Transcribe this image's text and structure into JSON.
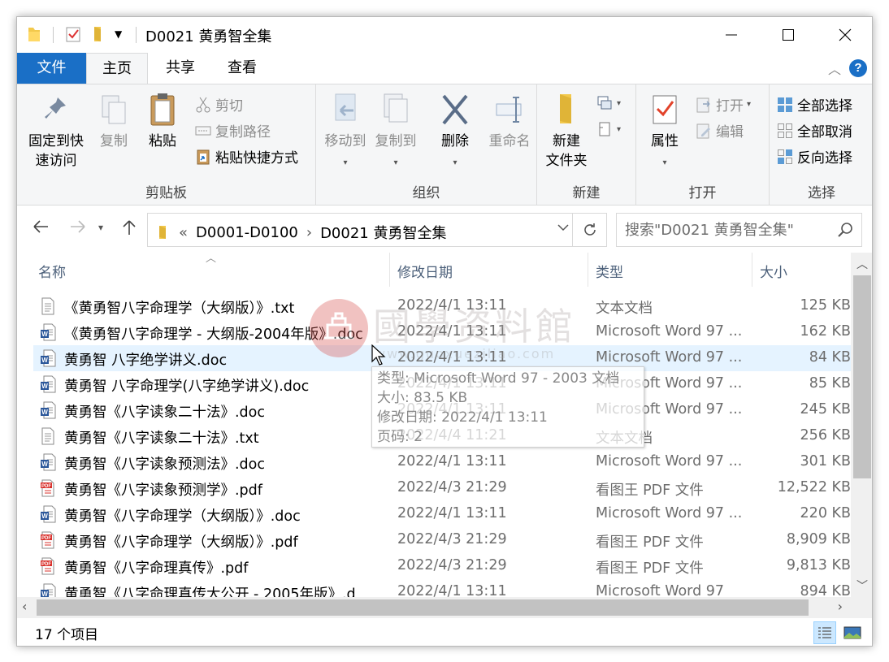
{
  "window": {
    "title": "D0021 黄勇智全集",
    "controls": {
      "minimize": "—",
      "maximize": "☐",
      "close": "✕"
    }
  },
  "ribbon_tabs": [
    {
      "label": "文件",
      "active": false
    },
    {
      "label": "主页",
      "active": true
    },
    {
      "label": "共享",
      "active": false
    },
    {
      "label": "查看",
      "active": false
    }
  ],
  "ribbon": {
    "clipboard": {
      "label": "剪贴板",
      "pin": "固定到快\n速访问",
      "pin_l1": "固定到快",
      "pin_l2": "速访问",
      "copy": "复制",
      "paste": "粘贴",
      "cut": "剪切",
      "copy_path": "复制路径",
      "paste_shortcut": "粘贴快捷方式"
    },
    "organize": {
      "label": "组织",
      "move_to": "移动到",
      "copy_to": "复制到",
      "delete": "删除",
      "rename": "重命名"
    },
    "new": {
      "label": "新建",
      "new_folder_l1": "新建",
      "new_folder_l2": "文件夹"
    },
    "open": {
      "label": "打开",
      "properties": "属性",
      "open": "打开",
      "edit": "编辑"
    },
    "select": {
      "label": "选择",
      "select_all": "全部选择",
      "select_none": "全部取消",
      "invert": "反向选择"
    }
  },
  "address": {
    "prefix": "«",
    "crumbs": [
      "D0001-D0100",
      "D0021 黄勇智全集"
    ],
    "separator": "›"
  },
  "search": {
    "placeholder": "搜索\"D0021 黄勇智全集\""
  },
  "columns": {
    "name": "名称",
    "date": "修改日期",
    "type": "类型",
    "size": "大小"
  },
  "files": [
    {
      "name": "《黄勇智八字命理学（大纲版）》.txt",
      "date": "2022/4/1 13:11",
      "type": "文本文档",
      "size": "125 KB",
      "icon": "txt-file-icon"
    },
    {
      "name": "《黄勇智八字命理学 - 大纲版-2004年版》.doc",
      "date": "2022/4/1 13:11",
      "type": "Microsoft Word 97 ...",
      "size": "162 KB",
      "icon": "word-file-icon"
    },
    {
      "name": "黄勇智 八字绝学讲义.doc",
      "date": "2022/4/1 13:11",
      "type": "Microsoft Word 97 ...",
      "size": "84 KB",
      "icon": "word-file-icon"
    },
    {
      "name": "黄勇智 八字命理学(八字绝学讲义).doc",
      "date": "2022/4/1 13:11",
      "type": "Microsoft Word 97 ...",
      "size": "85 KB",
      "icon": "word-file-icon"
    },
    {
      "name": "黄勇智《八字读象二十法》.doc",
      "date": "2022/4/1 13:11",
      "type": "Microsoft Word 97 ...",
      "size": "245 KB",
      "icon": "word-file-icon"
    },
    {
      "name": "黄勇智《八字读象二十法》.txt",
      "date": "2022/4/4 11:21",
      "type": "文本文档",
      "size": "256 KB",
      "icon": "txt-file-icon"
    },
    {
      "name": "黄勇智《八字读象预测法》.doc",
      "date": "2022/4/1 13:11",
      "type": "Microsoft Word 97 ...",
      "size": "301 KB",
      "icon": "word-file-icon"
    },
    {
      "name": "黄勇智《八字读象预测学》.pdf",
      "date": "2022/4/3 21:29",
      "type": "看图王 PDF 文件",
      "size": "12,522 KB",
      "icon": "pdf-file-icon"
    },
    {
      "name": "黄勇智《八字命理学（大纲版）》.doc",
      "date": "2022/4/1 13:11",
      "type": "Microsoft Word 97 ...",
      "size": "220 KB",
      "icon": "word-file-icon"
    },
    {
      "name": "黄勇智《八字命理学（大纲版）》.pdf",
      "date": "2022/4/3 21:29",
      "type": "看图王 PDF 文件",
      "size": "8,909 KB",
      "icon": "pdf-file-icon"
    },
    {
      "name": "黄勇智《八字命理真传》.pdf",
      "date": "2022/4/3 21:29",
      "type": "看图王 PDF 文件",
      "size": "9,813 KB",
      "icon": "pdf-file-icon"
    },
    {
      "name": "黄勇智《八字命理真传大公开 - 2005年版》.d",
      "date": "2022/4/1 13:11",
      "type": "Microsoft Word 97",
      "size": "894 KB",
      "icon": "word-file-icon"
    }
  ],
  "hovered_row": 2,
  "tooltip": {
    "type": "类型: Microsoft Word 97 - 2003 文档",
    "size": "大小: 83.5 KB",
    "modified": "修改日期: 2022/4/1 13:11",
    "pages": "页码: 2"
  },
  "watermark": {
    "title": "國學资料館",
    "url": "www.guoxueziliao.com"
  },
  "status": {
    "count": "17 个项目"
  },
  "colors": {
    "accent": "#1a6fc6",
    "hover": "#e5f3ff",
    "header_text": "#4c607a"
  }
}
